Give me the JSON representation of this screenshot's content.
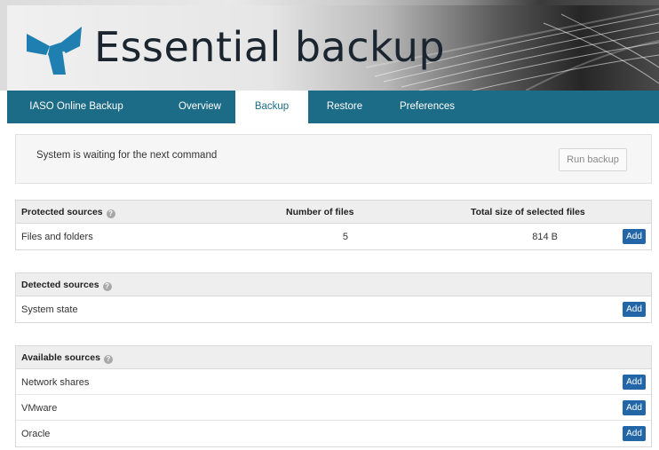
{
  "app": {
    "title": "Essential backup"
  },
  "colors": {
    "nav_bg": "#1d6c87",
    "add_button": "#2366a8",
    "logo": "#1e7fb0"
  },
  "nav": {
    "tabs": [
      {
        "label": "IASO Online Backup",
        "active": false
      },
      {
        "label": "Overview",
        "active": false
      },
      {
        "label": "Backup",
        "active": true
      },
      {
        "label": "Restore",
        "active": false
      },
      {
        "label": "Preferences",
        "active": false
      }
    ]
  },
  "status": {
    "message": "System is waiting for the next command",
    "run_backup_label": "Run backup"
  },
  "protected": {
    "title": "Protected sources",
    "col_files": "Number of files",
    "col_size": "Total size of selected files",
    "rows": [
      {
        "label": "Files and folders",
        "files": "5",
        "size": "814 B",
        "action": "Add"
      }
    ]
  },
  "detected": {
    "title": "Detected sources",
    "rows": [
      {
        "label": "System state",
        "action": "Add"
      }
    ]
  },
  "available": {
    "title": "Available sources",
    "rows": [
      {
        "label": "Network shares",
        "action": "Add"
      },
      {
        "label": "VMware",
        "action": "Add"
      },
      {
        "label": "Oracle",
        "action": "Add"
      }
    ]
  }
}
